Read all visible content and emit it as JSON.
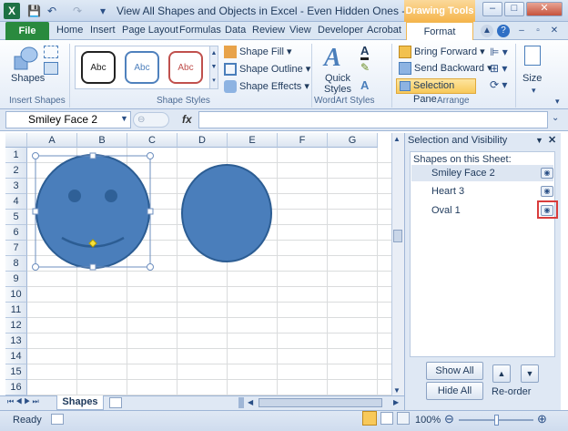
{
  "window": {
    "title": "View All Shapes and Objects in Excel - Even Hidden Ones - Micro...",
    "contextual_tab": "Drawing Tools",
    "minimize": "–",
    "maximize": "□",
    "close": "✕"
  },
  "quick_access": {
    "save": "💾",
    "undo": "↶",
    "redo": "↷",
    "customize": "▾"
  },
  "tabs": {
    "file": "File",
    "items": [
      "Home",
      "Insert",
      "Page Layout",
      "Formulas",
      "Data",
      "Review",
      "View",
      "Developer",
      "Acrobat"
    ],
    "format": "Format",
    "help": "?"
  },
  "ribbon": {
    "insert_shapes": {
      "label": "Insert Shapes",
      "shapes_btn": "Shapes"
    },
    "shape_styles": {
      "label": "Shape Styles",
      "gallery": [
        "Abc",
        "Abc",
        "Abc"
      ],
      "gallery_colors": [
        "#222222",
        "#4f81bd",
        "#c0504d"
      ],
      "fill": "Shape Fill",
      "outline": "Shape Outline",
      "effects": "Shape Effects"
    },
    "wordart": {
      "label": "WordArt Styles",
      "quick_styles": "Quick Styles"
    },
    "arrange": {
      "label": "Arrange",
      "bring_forward": "Bring Forward",
      "send_backward": "Send Backward",
      "selection_pane": "Selection Pane"
    },
    "size": {
      "label": "Size"
    }
  },
  "formula_bar": {
    "name_box": "Smiley Face 2",
    "fx": "fx",
    "value": ""
  },
  "grid": {
    "columns": [
      "A",
      "B",
      "C",
      "D",
      "E",
      "F",
      "G"
    ],
    "rows": [
      "1",
      "2",
      "3",
      "4",
      "5",
      "6",
      "7",
      "8",
      "9",
      "10",
      "11",
      "12",
      "13",
      "14",
      "15",
      "16"
    ]
  },
  "shapes": [
    {
      "name": "Smiley Face 2",
      "type": "smiley",
      "fill": "#4a7ebb",
      "stroke": "#2c5d93",
      "selected": true
    },
    {
      "name": "Oval 1",
      "type": "oval",
      "fill": "#4a7ebb",
      "stroke": "#2c5d93",
      "selected": false
    }
  ],
  "sheet_tabs": {
    "active": "Shapes"
  },
  "selection_pane": {
    "title": "Selection and Visibility",
    "subtitle": "Shapes on this Sheet:",
    "items": [
      "Smiley Face 2",
      "Heart 3",
      "Oval 1"
    ],
    "highlight_color": "#d93c3c",
    "show_all": "Show All",
    "hide_all": "Hide All",
    "reorder": "Re-order"
  },
  "status_bar": {
    "ready": "Ready",
    "zoom": "100%"
  }
}
